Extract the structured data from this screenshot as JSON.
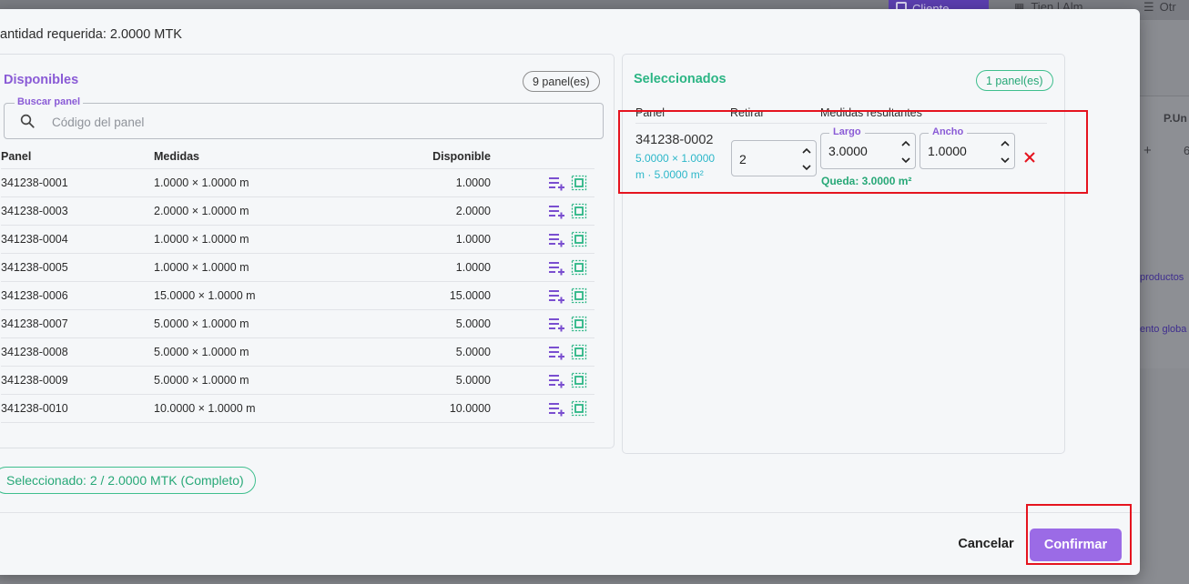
{
  "background": {
    "toolbar_button": "Cliente",
    "toolbar_text": "Tien | Alm",
    "toolbar_other": "Otr",
    "price_header": "P.Un",
    "plus": "+",
    "price_value": "6",
    "link_productos": "productos",
    "link_global": "ento globa"
  },
  "modal": {
    "required_quantity": "antidad requerida: 2.0000 MTK",
    "available": {
      "title": "Disponibles",
      "count_badge": "9 panel(es)",
      "search_label": "Buscar panel",
      "search_placeholder": "Código del panel",
      "columns": [
        "Panel",
        "Medidas",
        "Disponible"
      ],
      "rows": [
        {
          "panel": "341238-0001",
          "measures": "1.0000 × 1.0000 m",
          "available": "1.0000"
        },
        {
          "panel": "341238-0003",
          "measures": "2.0000 × 1.0000 m",
          "available": "2.0000"
        },
        {
          "panel": "341238-0004",
          "measures": "1.0000 × 1.0000 m",
          "available": "1.0000"
        },
        {
          "panel": "341238-0005",
          "measures": "1.0000 × 1.0000 m",
          "available": "1.0000"
        },
        {
          "panel": "341238-0006",
          "measures": "15.0000 × 1.0000 m",
          "available": "15.0000"
        },
        {
          "panel": "341238-0007",
          "measures": "5.0000 × 1.0000 m",
          "available": "5.0000"
        },
        {
          "panel": "341238-0008",
          "measures": "5.0000 × 1.0000 m",
          "available": "5.0000"
        },
        {
          "panel": "341238-0009",
          "measures": "5.0000 × 1.0000 m",
          "available": "5.0000"
        },
        {
          "panel": "341238-0010",
          "measures": "10.0000 × 1.0000 m",
          "available": "10.0000"
        }
      ]
    },
    "selected": {
      "title": "Seleccionados",
      "count_badge": "1 panel(es)",
      "col_panel": "Panel",
      "col_retirar": "Retirar",
      "col_result": "Medidas resultantes",
      "item": {
        "panel": "341238-0002",
        "dims": "5.0000 × 1.0000 m · 5.0000 m²",
        "retirar": "2",
        "largo_label": "Largo",
        "largo": "3.0000",
        "ancho_label": "Ancho",
        "ancho": "1.0000",
        "queda": "Queda: 3.0000 m²"
      }
    },
    "status": "Seleccionado: 2 / 2.0000 MTK (Completo)",
    "cancel": "Cancelar",
    "confirm": "Confirmar"
  },
  "colors": {
    "accent_purple": "#9b6be6",
    "success_green": "#27a877",
    "info_cyan": "#2cb7c9",
    "danger_red": "#e5141f"
  }
}
